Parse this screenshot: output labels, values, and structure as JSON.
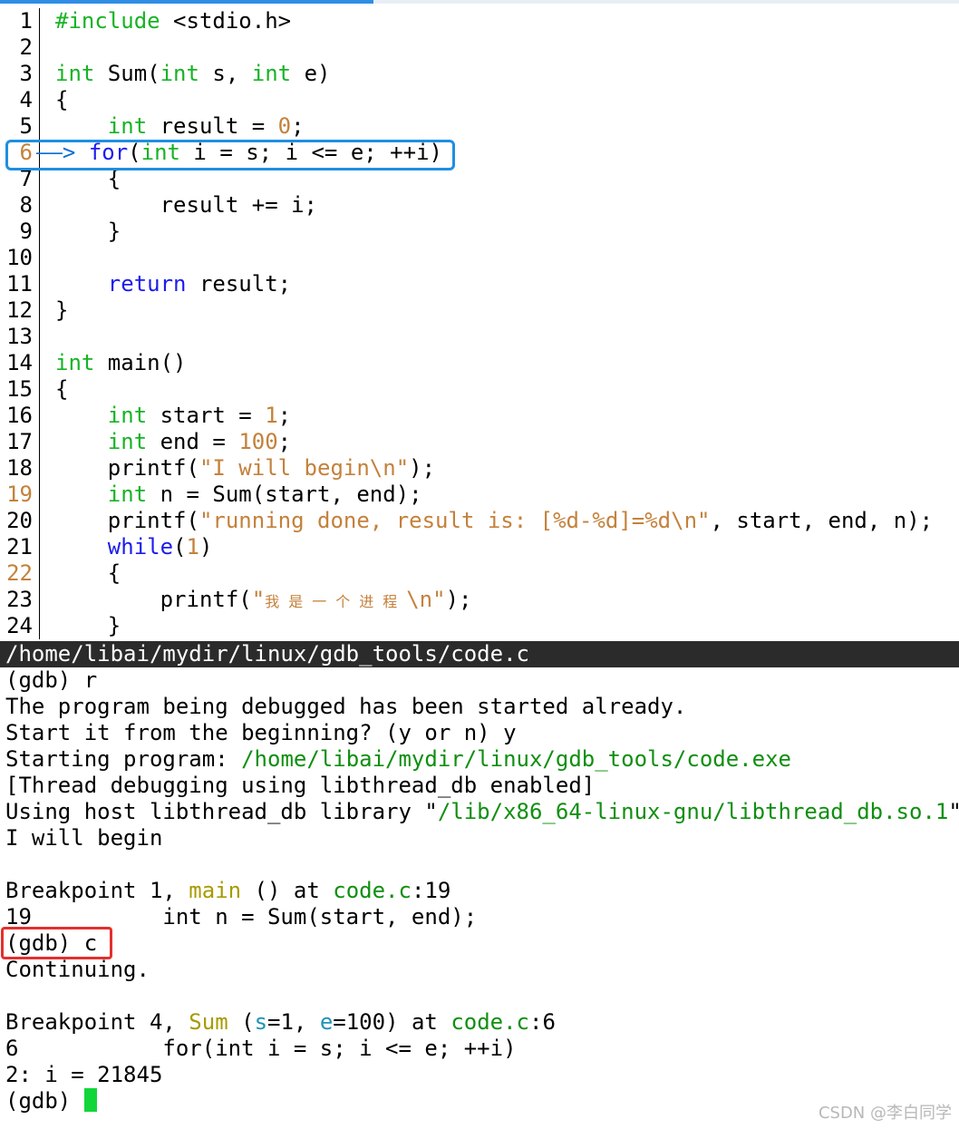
{
  "source": {
    "lines": [
      {
        "n": "1",
        "tokens": [
          {
            "t": "#include",
            "c": "k"
          },
          {
            "t": " <stdio.h>"
          }
        ]
      },
      {
        "n": "2",
        "tokens": []
      },
      {
        "n": "3",
        "tokens": [
          {
            "t": "int",
            "c": "k"
          },
          {
            "t": " Sum("
          },
          {
            "t": "int",
            "c": "k"
          },
          {
            "t": " s, "
          },
          {
            "t": "int",
            "c": "k"
          },
          {
            "t": " e)"
          }
        ]
      },
      {
        "n": "4",
        "tokens": [
          {
            "t": "{"
          }
        ]
      },
      {
        "n": "5",
        "tokens": [
          {
            "t": "    "
          },
          {
            "t": "int",
            "c": "k"
          },
          {
            "t": " result = "
          },
          {
            "t": "0",
            "c": "num"
          },
          {
            "t": ";"
          }
        ]
      },
      {
        "n": "6",
        "hl": true,
        "tokens": [
          {
            "t": "   ",
            "c": "arrow"
          },
          {
            "t": " "
          },
          {
            "t": "for",
            "c": "kb"
          },
          {
            "t": "("
          },
          {
            "t": "int",
            "c": "k"
          },
          {
            "t": " i = s; i <= e; ++i)"
          }
        ]
      },
      {
        "n": "7",
        "tokens": [
          {
            "t": "    {"
          }
        ]
      },
      {
        "n": "8",
        "tokens": [
          {
            "t": "        result += i;"
          }
        ]
      },
      {
        "n": "9",
        "tokens": [
          {
            "t": "    }"
          }
        ]
      },
      {
        "n": "10",
        "tokens": []
      },
      {
        "n": "11",
        "tokens": [
          {
            "t": "    "
          },
          {
            "t": "return",
            "c": "kb"
          },
          {
            "t": " result;"
          }
        ]
      },
      {
        "n": "12",
        "tokens": [
          {
            "t": "}"
          }
        ]
      },
      {
        "n": "13",
        "tokens": []
      },
      {
        "n": "14",
        "tokens": [
          {
            "t": "int",
            "c": "k"
          },
          {
            "t": " main()"
          }
        ]
      },
      {
        "n": "15",
        "tokens": [
          {
            "t": "{"
          }
        ]
      },
      {
        "n": "16",
        "tokens": [
          {
            "t": "    "
          },
          {
            "t": "int",
            "c": "k"
          },
          {
            "t": " start = "
          },
          {
            "t": "1",
            "c": "num"
          },
          {
            "t": ";"
          }
        ]
      },
      {
        "n": "17",
        "tokens": [
          {
            "t": "    "
          },
          {
            "t": "int",
            "c": "k"
          },
          {
            "t": " end = "
          },
          {
            "t": "100",
            "c": "num"
          },
          {
            "t": ";"
          }
        ]
      },
      {
        "n": "18",
        "tokens": [
          {
            "t": "    printf("
          },
          {
            "t": "\"I will begin\\n\"",
            "c": "str"
          },
          {
            "t": ");"
          }
        ]
      },
      {
        "n": "19",
        "hl": true,
        "tokens": [
          {
            "t": "    "
          },
          {
            "t": "int",
            "c": "k"
          },
          {
            "t": " n = Sum(start, end);"
          }
        ]
      },
      {
        "n": "20",
        "tokens": [
          {
            "t": "    printf("
          },
          {
            "t": "\"running done, result is: [%d-%d]=%d\\n\"",
            "c": "str"
          },
          {
            "t": ", start, end, n);"
          }
        ]
      },
      {
        "n": "21",
        "tokens": [
          {
            "t": "    "
          },
          {
            "t": "while",
            "c": "kb"
          },
          {
            "t": "("
          },
          {
            "t": "1",
            "c": "num"
          },
          {
            "t": ")"
          }
        ]
      },
      {
        "n": "22",
        "hl": true,
        "tokens": [
          {
            "t": "    {"
          }
        ]
      },
      {
        "n": "23",
        "tokens": [
          {
            "t": "        printf("
          },
          {
            "t": "\"",
            "c": "str"
          },
          {
            "t": "我是一个进程",
            "c": "str cjk"
          },
          {
            "t": "\\n\"",
            "c": "str"
          },
          {
            "t": ");"
          }
        ]
      },
      {
        "n": "24",
        "tokens": [
          {
            "t": "    }"
          }
        ]
      }
    ]
  },
  "arrow_glyph": "——>",
  "status_path": "/home/libai/mydir/linux/gdb_tools/code.c",
  "gdb": {
    "lines": [
      {
        "segs": [
          {
            "t": "(gdb) r"
          }
        ]
      },
      {
        "segs": [
          {
            "t": "The program being debugged has been started already."
          }
        ]
      },
      {
        "segs": [
          {
            "t": "Start it from the beginning? (y or n) y"
          }
        ]
      },
      {
        "segs": [
          {
            "t": "Starting program: "
          },
          {
            "t": "/home/libai/mydir/linux/gdb_tools/code.exe",
            "c": "g-green"
          }
        ]
      },
      {
        "segs": [
          {
            "t": "[Thread debugging using libthread_db enabled]"
          }
        ]
      },
      {
        "segs": [
          {
            "t": "Using host libthread_db library \""
          },
          {
            "t": "/lib/x86_64-linux-gnu/libthread_db.so.1",
            "c": "g-green"
          },
          {
            "t": "\"."
          }
        ]
      },
      {
        "segs": [
          {
            "t": "I will begin"
          }
        ]
      },
      {
        "segs": [
          {
            "t": ""
          }
        ]
      },
      {
        "segs": [
          {
            "t": "Breakpoint 1, "
          },
          {
            "t": "main",
            "c": "g-olive"
          },
          {
            "t": " () at "
          },
          {
            "t": "code.c",
            "c": "g-green"
          },
          {
            "t": ":19"
          }
        ]
      },
      {
        "segs": [
          {
            "t": "19          int n = Sum(start, end);"
          }
        ]
      },
      {
        "segs": [
          {
            "t": "(gdb) c"
          }
        ]
      },
      {
        "segs": [
          {
            "t": "Continuing."
          }
        ]
      },
      {
        "segs": [
          {
            "t": ""
          }
        ]
      },
      {
        "segs": [
          {
            "t": "Breakpoint 4, "
          },
          {
            "t": "Sum",
            "c": "g-olive"
          },
          {
            "t": " ("
          },
          {
            "t": "s",
            "c": "g-cyan"
          },
          {
            "t": "=1, "
          },
          {
            "t": "e",
            "c": "g-cyan"
          },
          {
            "t": "=100) at "
          },
          {
            "t": "code.c",
            "c": "g-green"
          },
          {
            "t": ":6"
          }
        ]
      },
      {
        "segs": [
          {
            "t": "6           for(int i = s; i <= e; ++i)"
          }
        ]
      },
      {
        "segs": [
          {
            "t": "2: i = 21845"
          }
        ]
      },
      {
        "segs": [
          {
            "t": "(gdb) "
          }
        ],
        "cursor": true
      }
    ]
  },
  "watermark": "CSDN @李白同学",
  "colors": {
    "type_keyword": "#17b325",
    "control_keyword": "#1c1cee",
    "literal": "#c4813b",
    "path_green": "#0f8f0f",
    "function_olive": "#a89a00",
    "cursor_green": "#11d63a",
    "highlight_box_blue": "#1e8fe1",
    "highlight_box_red": "#e2302e",
    "statusbar_bg": "#2b2b2b"
  }
}
